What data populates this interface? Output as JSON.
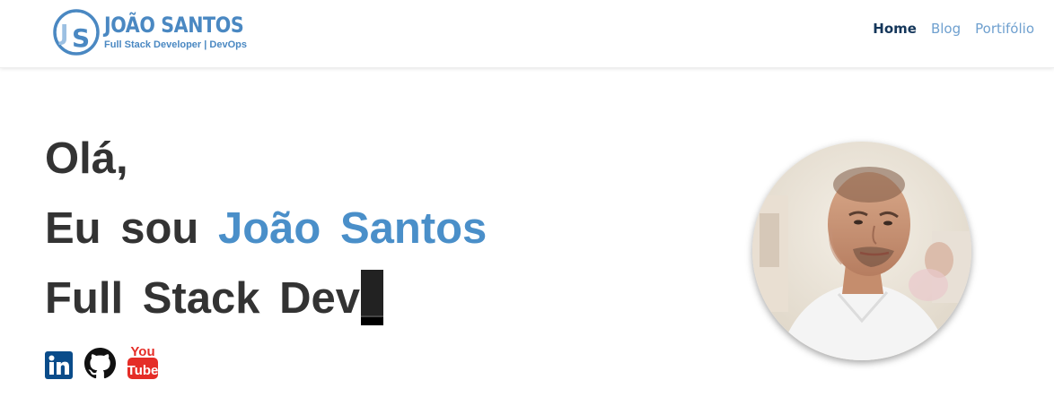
{
  "brand": {
    "logo_letters": "JS",
    "name": "JOÃO SANTOS",
    "tagline": "Full Stack Developer | DevOps"
  },
  "nav": {
    "items": [
      {
        "label": "Home",
        "active": true
      },
      {
        "label": "Blog",
        "active": false
      },
      {
        "label": "Portifólio",
        "active": false
      }
    ]
  },
  "hero": {
    "greeting": "Olá,",
    "intro_prefix": "Eu sou",
    "intro_name": "João Santos",
    "role_typed": "Full Stack Dev"
  },
  "socials": [
    {
      "icon": "linkedin-icon",
      "label": "in"
    },
    {
      "icon": "github-icon"
    },
    {
      "icon": "youtube-icon",
      "label_top": "You",
      "label_bottom": "Tube"
    }
  ],
  "colors": {
    "accent": "#4a8fc9",
    "nav_active": "#14365a",
    "nav_inactive": "#6fa0cf",
    "text": "#333333",
    "linkedin": "#0a4c8a",
    "youtube": "#e52d27"
  }
}
